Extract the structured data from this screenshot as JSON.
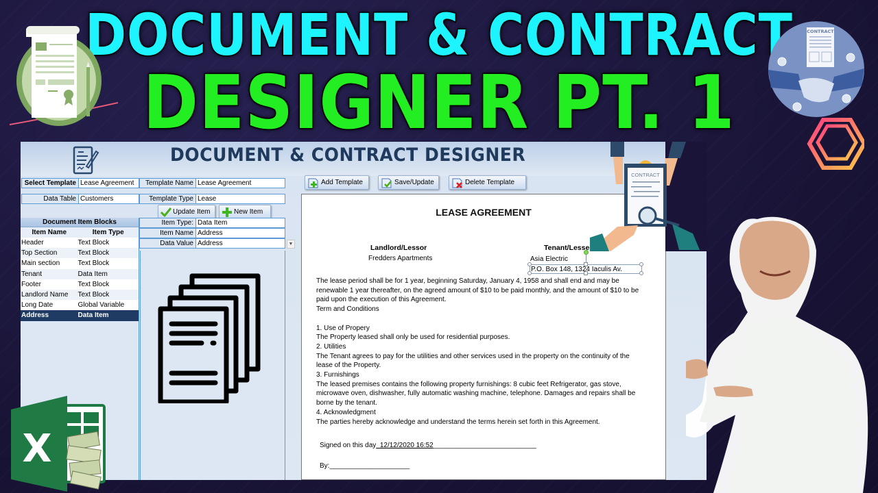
{
  "thumbnail": {
    "title_line_1": "DOCUMENT & CONTRACT",
    "title_line_2": "DESIGNER PT. 1",
    "colors": {
      "line1": "#1ef4ff",
      "line2": "#22ee22",
      "background": "#1a1538"
    }
  },
  "decor": {
    "handshake_badge_text": "CONTRACT",
    "contract_clipboard_text": "CONTRACT",
    "excel_letter": "X"
  },
  "app": {
    "title": "DOCUMENT & CONTRACT DESIGNER",
    "fields": {
      "select_template": {
        "label": "Select Template",
        "value": "Lease Agreement"
      },
      "template_name": {
        "label": "Template Name",
        "value": "Lease Agreement"
      },
      "data_table": {
        "label": "Data Table",
        "value": "Customers"
      },
      "template_type": {
        "label": "Template Type",
        "value": "Lease"
      },
      "item_type": {
        "label": "Item Type:",
        "value": "Data Item"
      },
      "item_name": {
        "label": "Item Name",
        "value": "Address"
      },
      "data_value": {
        "label": "Data Value",
        "value": "Address"
      }
    },
    "buttons": {
      "update_item": "Update Item",
      "new_item": "New Item",
      "add_template": "Add Template",
      "save_update": "Save/Update",
      "delete_template": "Delete Template"
    },
    "item_blocks": {
      "heading": "Document Item Blocks",
      "columns": [
        "Item Name",
        "Item Type"
      ],
      "rows": [
        {
          "name": "Header",
          "type": "Text Block"
        },
        {
          "name": "Top Section",
          "type": "Text Block"
        },
        {
          "name": "Main section",
          "type": "Text Block"
        },
        {
          "name": "Tenant",
          "type": "Data Item"
        },
        {
          "name": "Footer",
          "type": "Text Block"
        },
        {
          "name": "Landlord Name",
          "type": "Text Block"
        },
        {
          "name": "Long Date",
          "type": "Global Variable"
        },
        {
          "name": "Address",
          "type": "Data Item"
        }
      ],
      "selected_index": 7
    },
    "document": {
      "title": "LEASE AGREEMENT",
      "landlord_heading": "Landlord/Lessor",
      "landlord_value": "Fredders Apartments",
      "tenant_heading": "Tenant/Lessee",
      "tenant_value": "Asia Electric",
      "tenant_address": "P.O. Box 148,  1324  Iaculis Av.",
      "paragraphs": [
        "The lease period shall be for 1 year, beginning Saturday, January 4, 1958  and shall end and may be",
        "renewable 1 year thereafter, on the agreed amount of $10 to be paid monthly, and the amount of $10 to be",
        "paid upon the execution of this Agreement.",
        "Term and Conditions",
        "",
        "1. Use of Propery",
        "The Property leased shall only be used for residential purposes.",
        "2. Utilities",
        "The Tenant agrees to pay for the utilities and other services used in the property on the continuity of the",
        "lease of the Property.",
        "3. Furnishings",
        "The leased premises contains the following property furnishings: 8 cubic feet Refrigerator, gas stove,",
        "microwave oven, dishwasher, fully automatic washing machine, telephone. Damages and repairs shall be",
        "borne by the tenant.",
        "4. Acknowledgment",
        "The parties hereby acknowledge and understand the terms herein set forth in this Agreement."
      ],
      "signed_label": "Signed on this day",
      "signed_value": "12/12/2020  16:52",
      "signed_trailing": "___________________________",
      "by_label": "By:",
      "by_line": "_____________________"
    }
  }
}
